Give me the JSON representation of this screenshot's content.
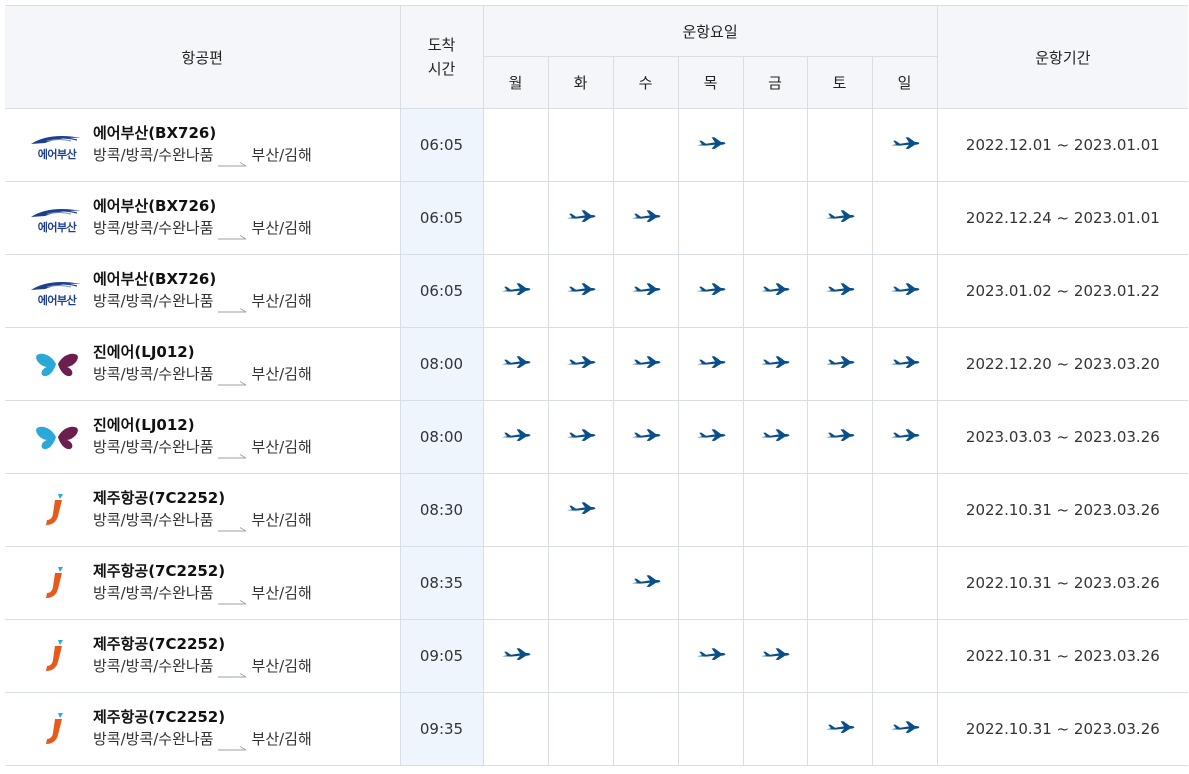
{
  "header": {
    "flight": "항공편",
    "arrival": "도착\n시간",
    "days_group": "운항요일",
    "days": [
      "월",
      "화",
      "수",
      "목",
      "금",
      "토",
      "일"
    ],
    "period": "운항기간"
  },
  "colors": {
    "plane": "#0b4f8a",
    "airbusan": "#1e3f8f",
    "jinair": "#2aa8d8",
    "jejuair": "#e85a1b"
  },
  "rows": [
    {
      "logo": "airbusan",
      "logo_text": "에어부산",
      "name": "에어부산(BX726)",
      "from": "방콕/방콕/수완나품",
      "to": "부산/김해",
      "arrival": "06:05",
      "days": [
        false,
        false,
        false,
        true,
        false,
        false,
        true
      ],
      "period": "2022.12.01 ~ 2023.01.01"
    },
    {
      "logo": "airbusan",
      "logo_text": "에어부산",
      "name": "에어부산(BX726)",
      "from": "방콕/방콕/수완나품",
      "to": "부산/김해",
      "arrival": "06:05",
      "days": [
        false,
        true,
        true,
        false,
        false,
        true,
        false
      ],
      "period": "2022.12.24 ~ 2023.01.01"
    },
    {
      "logo": "airbusan",
      "logo_text": "에어부산",
      "name": "에어부산(BX726)",
      "from": "방콕/방콕/수완나품",
      "to": "부산/김해",
      "arrival": "06:05",
      "days": [
        true,
        true,
        true,
        true,
        true,
        true,
        true
      ],
      "period": "2023.01.02 ~ 2023.01.22"
    },
    {
      "logo": "jinair",
      "logo_text": "",
      "name": "진에어(LJ012)",
      "from": "방콕/방콕/수완나품",
      "to": "부산/김해",
      "arrival": "08:00",
      "days": [
        true,
        true,
        true,
        true,
        true,
        true,
        true
      ],
      "period": "2022.12.20 ~ 2023.03.20"
    },
    {
      "logo": "jinair",
      "logo_text": "",
      "name": "진에어(LJ012)",
      "from": "방콕/방콕/수완나품",
      "to": "부산/김해",
      "arrival": "08:00",
      "days": [
        true,
        true,
        true,
        true,
        true,
        true,
        true
      ],
      "period": "2023.03.03 ~ 2023.03.26"
    },
    {
      "logo": "jejuair",
      "logo_text": "",
      "name": "제주항공(7C2252)",
      "from": "방콕/방콕/수완나품",
      "to": "부산/김해",
      "arrival": "08:30",
      "days": [
        false,
        true,
        false,
        false,
        false,
        false,
        false
      ],
      "period": "2022.10.31 ~ 2023.03.26"
    },
    {
      "logo": "jejuair",
      "logo_text": "",
      "name": "제주항공(7C2252)",
      "from": "방콕/방콕/수완나품",
      "to": "부산/김해",
      "arrival": "08:35",
      "days": [
        false,
        false,
        true,
        false,
        false,
        false,
        false
      ],
      "period": "2022.10.31 ~ 2023.03.26"
    },
    {
      "logo": "jejuair",
      "logo_text": "",
      "name": "제주항공(7C2252)",
      "from": "방콕/방콕/수완나품",
      "to": "부산/김해",
      "arrival": "09:05",
      "days": [
        true,
        false,
        false,
        true,
        true,
        false,
        false
      ],
      "period": "2022.10.31 ~ 2023.03.26"
    },
    {
      "logo": "jejuair",
      "logo_text": "",
      "name": "제주항공(7C2252)",
      "from": "방콕/방콕/수완나품",
      "to": "부산/김해",
      "arrival": "09:35",
      "days": [
        false,
        false,
        false,
        false,
        false,
        true,
        true
      ],
      "period": "2022.10.31 ~ 2023.03.26"
    }
  ]
}
